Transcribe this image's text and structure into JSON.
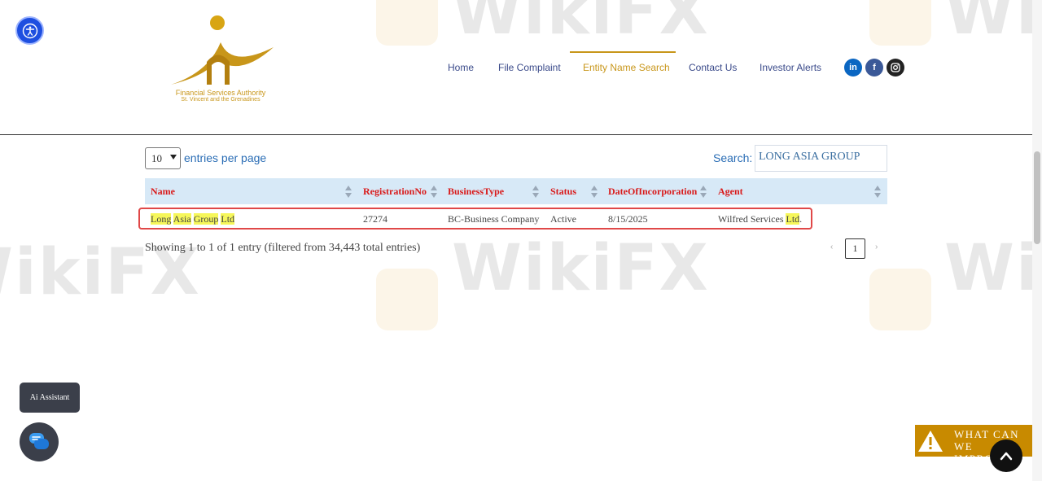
{
  "header": {
    "logo_line1": "Financial Services Authority",
    "logo_line2": "St. Vincent and the Grenadines",
    "nav": [
      "Home",
      "File Complaint",
      "Entity Name Search",
      "Contact Us",
      "Investor Alerts"
    ],
    "active_nav": "Entity Name Search",
    "social": {
      "linkedin": "in",
      "facebook": "f"
    },
    "colors": {
      "accent": "#c8961a",
      "nav": "#3a4a8a",
      "linkedin": "#0a66c2",
      "facebook": "#3b5998",
      "instagram": "#222222"
    }
  },
  "controls": {
    "per_page_value": "10",
    "per_page_label": "entries per page",
    "search_label": "Search:",
    "search_value": "LONG ASIA GROUP"
  },
  "table": {
    "columns": [
      "Name",
      "RegistrationNo",
      "BusinessType",
      "Status",
      "DateOfIncorporation",
      "Agent"
    ],
    "rows": [
      {
        "name_parts": [
          "Long",
          "Asia",
          "Group",
          "Ltd"
        ],
        "registration_no": "27274",
        "business_type": "BC-Business Company",
        "status": "Active",
        "date_of_incorporation": "8/15/2025",
        "agent_prefix": "Wilfred Services ",
        "agent_highlight": "Ltd",
        "agent_suffix": "."
      }
    ]
  },
  "footer": {
    "info": "Showing 1 to 1 of 1 entry (filtered from 34,443 total entries)",
    "page_prev": "‹",
    "page_current": "1",
    "page_next": "›"
  },
  "widgets": {
    "ai_assistant": "Ai Assistant",
    "improve_line1": "WHAT CAN",
    "improve_line2": "WE IMPROVE?"
  },
  "watermark": "WikiFX"
}
